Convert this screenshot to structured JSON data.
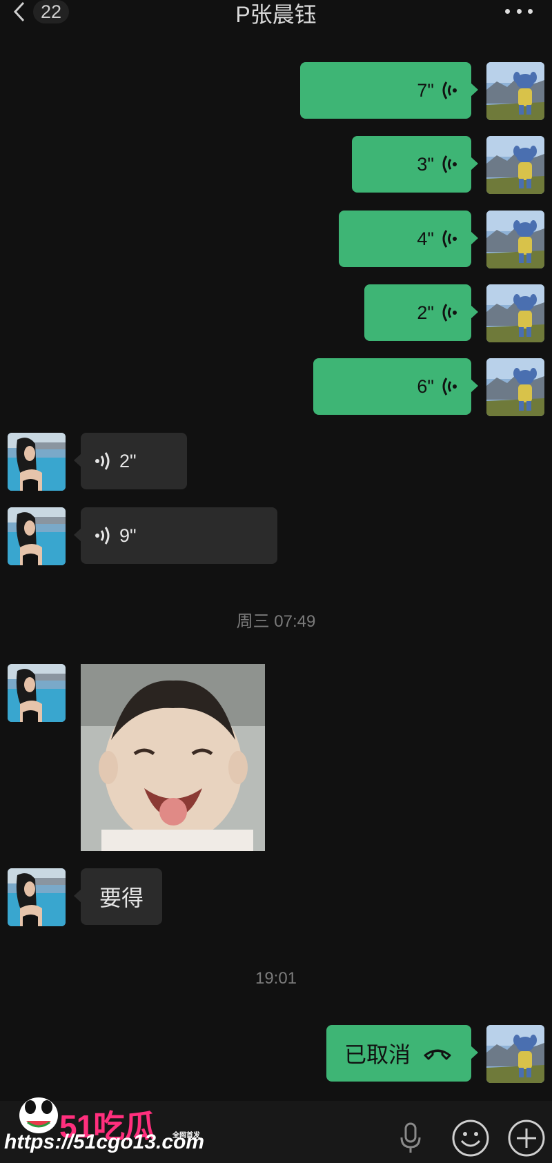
{
  "header": {
    "unread_count": "22",
    "title": "P张晨钰"
  },
  "messages": {
    "outgoing_voice": [
      {
        "duration": "7\""
      },
      {
        "duration": "3\""
      },
      {
        "duration": "4\""
      },
      {
        "duration": "2\""
      },
      {
        "duration": "6\""
      }
    ],
    "incoming_voice": [
      {
        "duration": "2\""
      },
      {
        "duration": "9\""
      }
    ],
    "timestamp_1": "周三 07:49",
    "incoming_text": "要得",
    "timestamp_2": "19:01",
    "outgoing_call": "已取消"
  },
  "watermark": {
    "brand": "51吃瓜",
    "tag": "全网首发",
    "url": "https://51cgo13.com"
  },
  "icons": [
    "back-chevron-icon",
    "more-icon",
    "voice-wave-icon",
    "phone-hangup-icon",
    "microphone-icon",
    "emoji-icon",
    "plus-icon"
  ],
  "colors": {
    "background": "#111111",
    "outgoing_bubble": "#3eb575",
    "incoming_bubble": "#2b2b2b",
    "watermark": "#ff2f7d"
  }
}
